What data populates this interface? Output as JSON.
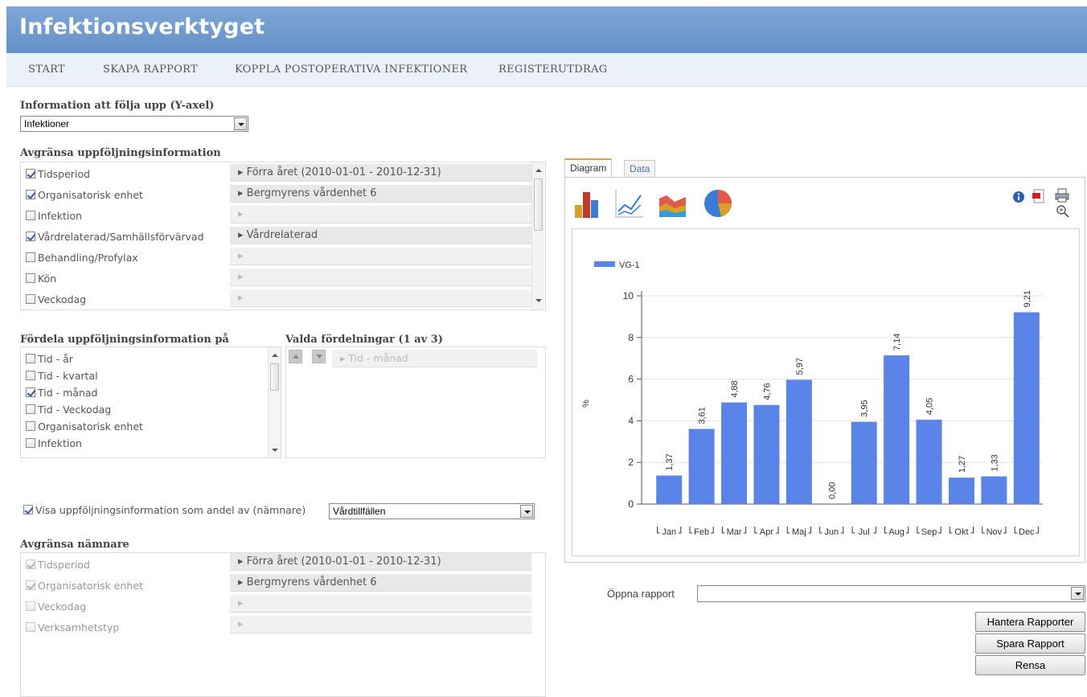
{
  "app": {
    "title": "Infektionsverktyget"
  },
  "nav": [
    "START",
    "SKAPA RAPPORT",
    "KOPPLA POSTOPERATIVA INFEKTIONER",
    "REGISTERUTDRAG"
  ],
  "yaxis": {
    "label": "Information att följa upp (Y-axel)",
    "value": "Infektioner"
  },
  "limit": {
    "label": "Avgränsa uppföljningsinformation",
    "items": [
      {
        "label": "Tidsperiod",
        "checked": true,
        "value": "Förra året (2010-01-01 - 2010-12-31)"
      },
      {
        "label": "Organisatorisk enhet",
        "checked": true,
        "value": "Bergmyrens vårdenhet 6"
      },
      {
        "label": "Infektion",
        "checked": false,
        "value": ""
      },
      {
        "label": "Vårdrelaterad/Samhällsförvärvad",
        "checked": true,
        "value": "Vårdrelaterad"
      },
      {
        "label": "Behandling/Profylax",
        "checked": false,
        "value": ""
      },
      {
        "label": "Kön",
        "checked": false,
        "value": ""
      },
      {
        "label": "Veckodag",
        "checked": false,
        "value": ""
      }
    ]
  },
  "distribute": {
    "label": "Fördela uppföljningsinformation på",
    "items": [
      {
        "label": "Tid - år",
        "checked": false
      },
      {
        "label": "Tid - kvartal",
        "checked": false
      },
      {
        "label": "Tid - månad",
        "checked": true
      },
      {
        "label": "Tid - Veckodag",
        "checked": false
      },
      {
        "label": "Organisatorisk enhet",
        "checked": false
      },
      {
        "label": "Infektion",
        "checked": false
      }
    ],
    "selected_label": "Valda fördelningar (1 av 3)",
    "selected_value": "Tid - månad"
  },
  "ratio": {
    "label": "Visa uppföljningsinformation som andel av (nämnare)",
    "checked": true,
    "value": "Vårdtillfällen"
  },
  "denominator": {
    "label": "Avgränsa nämnare",
    "items": [
      {
        "label": "Tidsperiod",
        "checked": true,
        "value": "Förra året (2010-01-01 - 2010-12-31)"
      },
      {
        "label": "Organisatorisk enhet",
        "checked": true,
        "value": "Bergmyrens vårdenhet 6"
      },
      {
        "label": "Veckodag",
        "checked": false,
        "value": ""
      },
      {
        "label": "Verksamhetstyp",
        "checked": false,
        "value": ""
      }
    ]
  },
  "tabs": [
    "Diagram",
    "Data"
  ],
  "toolbar": {
    "chart_types": [
      "bar-chart-icon",
      "line-chart-icon",
      "area-chart-icon",
      "pie-chart-icon"
    ],
    "actions": [
      "info-icon",
      "pdf-icon",
      "print-icon",
      "zoom-icon"
    ]
  },
  "report": {
    "open_label": "Öppna rapport",
    "open_value": "",
    "buttons": [
      "Hantera Rapporter",
      "Spara Rapport",
      "Rensa"
    ]
  },
  "chart_data": {
    "type": "bar",
    "categories": [
      "Jan",
      "Feb",
      "Mar",
      "Apr",
      "Maj",
      "Jun",
      "Jul",
      "Aug",
      "Sep",
      "Okt",
      "Nov",
      "Dec"
    ],
    "series": [
      {
        "name": "VG-1",
        "values": [
          1.37,
          3.61,
          4.88,
          4.76,
          5.97,
          0.0,
          3.95,
          7.14,
          4.05,
          1.27,
          1.33,
          9.21
        ]
      }
    ],
    "value_labels": [
      "1,37",
      "3,61",
      "4,88",
      "4,76",
      "5,97",
      "0,00",
      "3,95",
      "7,14",
      "4,05",
      "1,27",
      "1,33",
      "9,21"
    ],
    "ylabel": "%",
    "ylim": [
      0,
      10
    ],
    "yticks": [
      0,
      2,
      4,
      6,
      8,
      10
    ],
    "grid": true,
    "legend": "top-left",
    "color": "#5b84e8"
  }
}
